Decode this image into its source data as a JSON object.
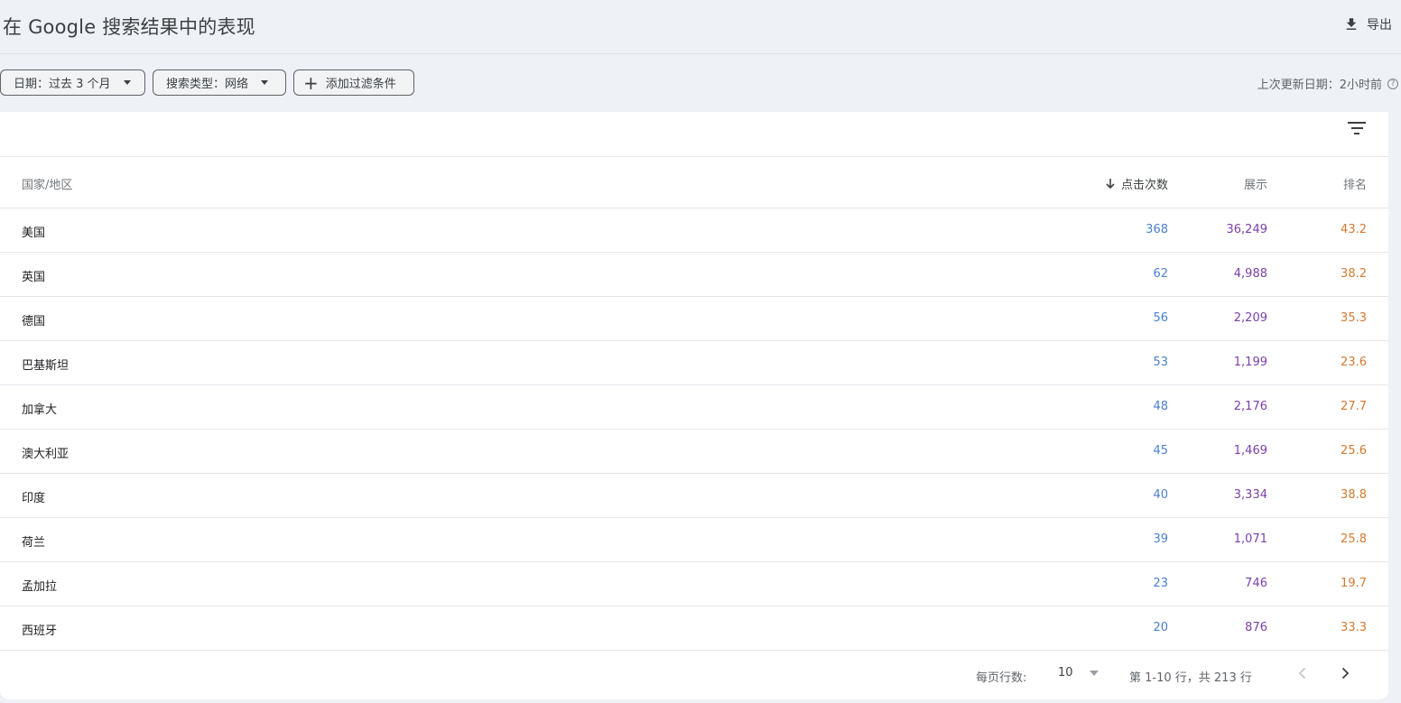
{
  "header": {
    "title": "在 Google 搜索结果中的表现",
    "export_label": "导出"
  },
  "filters": {
    "date_label": "日期：过去 3 个月",
    "type_label": "搜索类型：网络",
    "add_label": "添加过滤条件",
    "updated": "上次更新日期：2小时前",
    "help_glyph": "?"
  },
  "table": {
    "columns": {
      "country": "国家/地区",
      "clicks": "点击次数",
      "impressions": "展示",
      "position": "排名"
    },
    "rows": [
      {
        "country": "美国",
        "clicks": "368",
        "impressions": "36,249",
        "position": "43.2"
      },
      {
        "country": "英国",
        "clicks": "62",
        "impressions": "4,988",
        "position": "38.2"
      },
      {
        "country": "德国",
        "clicks": "56",
        "impressions": "2,209",
        "position": "35.3"
      },
      {
        "country": "巴基斯坦",
        "clicks": "53",
        "impressions": "1,199",
        "position": "23.6"
      },
      {
        "country": "加拿大",
        "clicks": "48",
        "impressions": "2,176",
        "position": "27.7"
      },
      {
        "country": "澳大利亚",
        "clicks": "45",
        "impressions": "1,469",
        "position": "25.6"
      },
      {
        "country": "印度",
        "clicks": "40",
        "impressions": "3,334",
        "position": "38.8"
      },
      {
        "country": "荷兰",
        "clicks": "39",
        "impressions": "1,071",
        "position": "25.8"
      },
      {
        "country": "孟加拉",
        "clicks": "23",
        "impressions": "746",
        "position": "19.7"
      },
      {
        "country": "西班牙",
        "clicks": "20",
        "impressions": "876",
        "position": "33.3"
      }
    ]
  },
  "footer": {
    "rows_per_page_label": "每页行数:",
    "rows_per_page_value": "10",
    "range_text": "第 1-10 行，共 213 行"
  },
  "colors": {
    "clicks": "#4a7fd0",
    "impressions": "#7b3fa8",
    "position": "#d27a31"
  },
  "icons": [
    "download-icon",
    "dropdown-caret-icon",
    "plus-icon",
    "help-icon",
    "filter-icon",
    "sort-arrow-down-icon",
    "chevron-left-icon",
    "chevron-right-icon"
  ]
}
